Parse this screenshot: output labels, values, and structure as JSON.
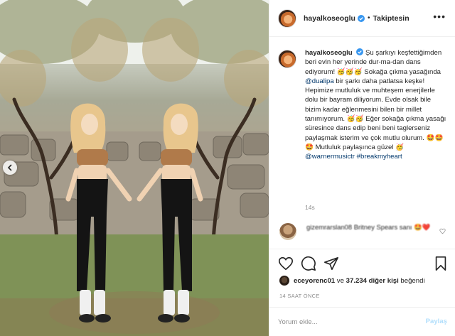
{
  "post": {
    "username": "hayalkoseoglu",
    "follow_state": "Takiptesin",
    "caption": {
      "text_1": "Şu şarkıyı keşfettiğimden beri evin her yerinde dur-ma-dan dans ediyorum! 🥳🥳🥳 Sokağa çıkma yasağında ",
      "mention_1": "@dualipa",
      "text_2": " bir şarkı daha patlatsa keşke! Hepimize mutluluk ve muhteşem enerjilerle dolu bir bayram diliyorum. Evde olsak bile bizim kadar eğlenmesini bilen bir millet tanımıyorum. 🥳🥳 Eğer sokağa çıkma yasağı süresince dans edip beni beni taglerseniz paylaşmak isterim ve çok mutlu olurum. 🤩🤩🤩 Mutluluk paylaşınca güzel 🥳 ",
      "mention_2": "@warnermusictr",
      "mention_3": "#breakmyheart",
      "time": "14s"
    },
    "comment": {
      "user": "gizemrarslan08",
      "text": "Britney Spears sanı 🤩❤️"
    },
    "likes": {
      "first_liker": "eceyorenc01",
      "connector": " ve ",
      "count_text": "37.234 diğer kişi",
      "suffix": " beğendi"
    },
    "posted_ago": "14 SAAT ÖNCE",
    "add_comment": {
      "placeholder": "Yorum ekle...",
      "submit_label": "Paylaş"
    }
  },
  "icons": {
    "verified": "verified-badge-icon",
    "more": "more-options-icon",
    "like": "heart-icon",
    "comment": "comment-bubble-icon",
    "share": "paper-plane-icon",
    "save": "bookmark-icon",
    "prev": "chevron-left-icon"
  },
  "colors": {
    "verified_blue": "#3897f0",
    "link": "#00376b",
    "muted": "#8e8e8e",
    "submit_disabled": "#b2dffc",
    "border": "#efefef"
  }
}
